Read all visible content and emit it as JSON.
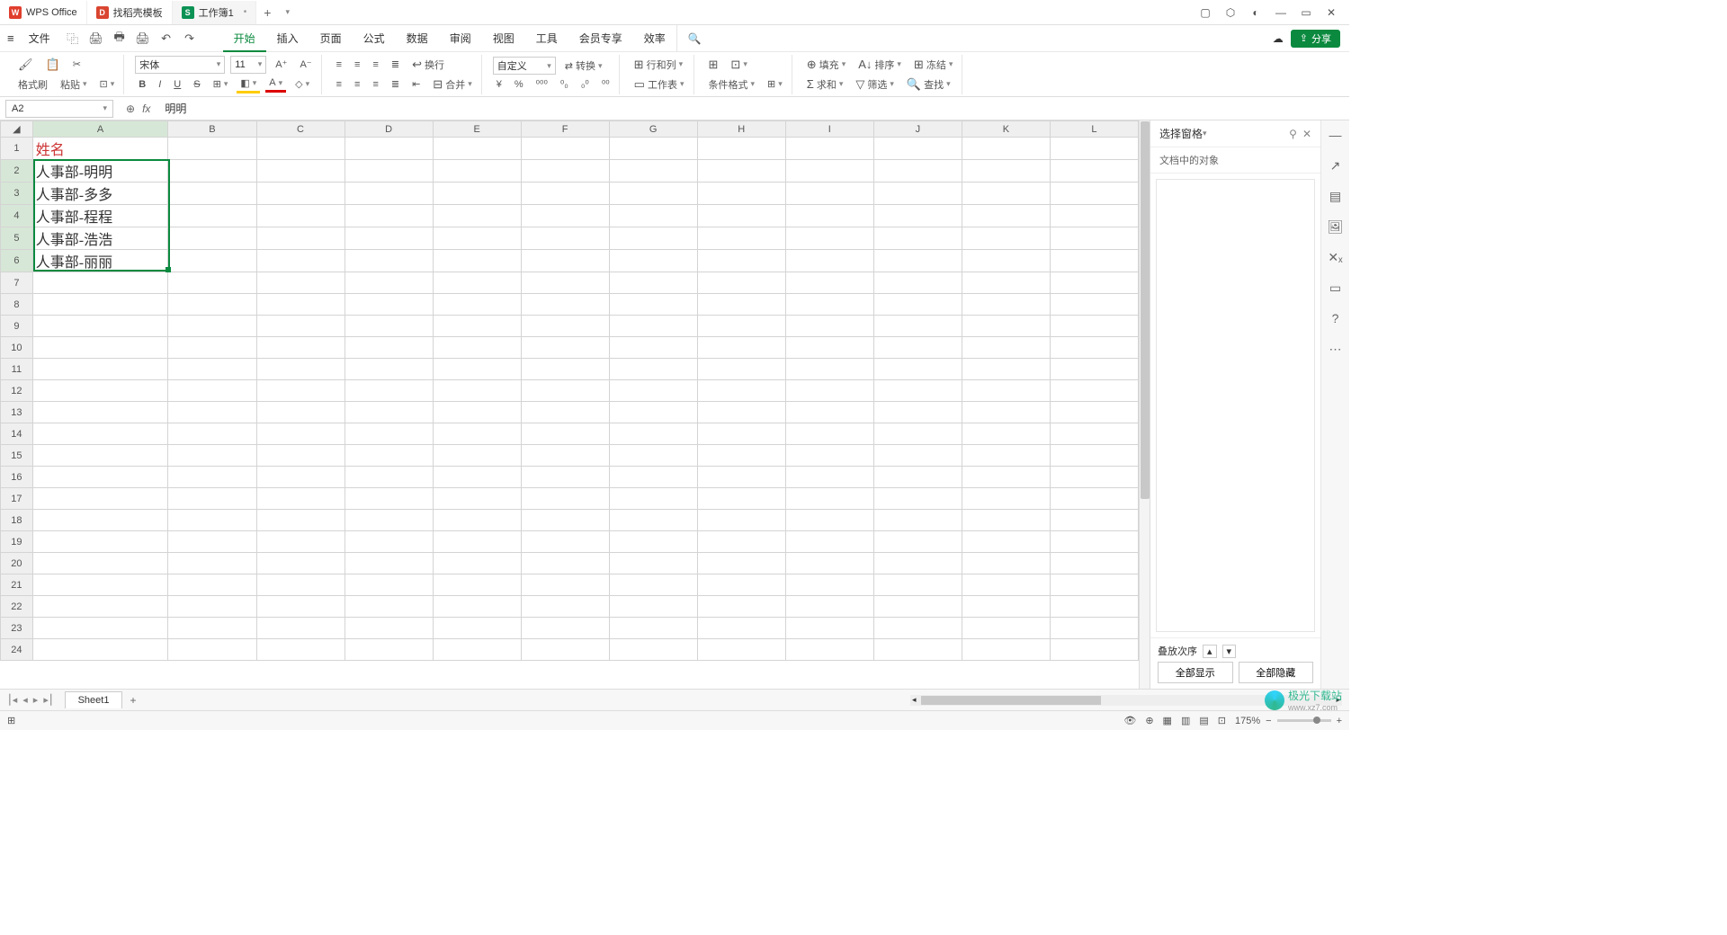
{
  "titlebar": {
    "tabs": [
      {
        "icon": "W",
        "icon_color": "red",
        "label": "WPS Office",
        "close": false
      },
      {
        "icon": "D",
        "icon_color": "dark",
        "label": "找稻壳模板",
        "close": false
      },
      {
        "icon": "S",
        "icon_color": "green",
        "label": "工作簿1",
        "close": true
      }
    ],
    "add": "+",
    "dd": "▾"
  },
  "winicons": [
    "▢",
    "⬡",
    "◐",
    "—",
    "▭",
    "✕"
  ],
  "menubar": {
    "hamburger": "≡",
    "file": "文件",
    "qat": [
      "⿻",
      "🖨",
      "🖶",
      "🖨",
      "↶",
      "↷"
    ],
    "tabs": [
      "开始",
      "插入",
      "页面",
      "公式",
      "数据",
      "审阅",
      "视图",
      "工具",
      "会员专享",
      "效率"
    ],
    "active": 0,
    "search": "🔍",
    "cloud": "☁",
    "share_icon": "⇪",
    "share": "分享"
  },
  "ribbon": {
    "painter": "格式刷",
    "paste": "粘贴",
    "cut": "✂",
    "font": "宋体",
    "size": "11",
    "Aup": "A⁺",
    "Adn": "A⁻",
    "B": "B",
    "I": "I",
    "U": "U",
    "S": "S",
    "box": "⊞",
    "fill": "◧",
    "color": "A",
    "clear": "◇",
    "al": "≡",
    "ac": "≡",
    "ar": "≡",
    "aj": "≣",
    "wrap": "换行",
    "vl": "≡",
    "vc": "≡",
    "vr": "≡",
    "vj": "≣",
    "indent": "⇤",
    "merge": "合并",
    "numfmt": "自定义",
    "convert": "转换",
    "curr": "¥",
    "pct": "%",
    "comma": "⁰⁰⁰",
    "dec1": "⁰₀",
    "dec2": "₀⁰",
    "exp": "⁰⁰",
    "rowcol": "行和列",
    "worksheet": "工作表",
    "tbl": "⊞",
    "style": "⊡",
    "condfmt": "条件格式",
    "border": "⊞",
    "fill2": "填充",
    "sort": "排序",
    "freeze": "冻结",
    "sum": "求和",
    "filter": "筛选",
    "find": "查找"
  },
  "fxbar": {
    "ref": "A2",
    "expand": "⊕",
    "fx": "fx",
    "formula": "明明"
  },
  "columns": [
    "A",
    "B",
    "C",
    "D",
    "E",
    "F",
    "G",
    "H",
    "I",
    "J",
    "K",
    "L"
  ],
  "rows_count": 24,
  "cells": {
    "A1": {
      "v": "姓名",
      "hdr": true
    },
    "A2": {
      "v": "人事部-明明"
    },
    "A3": {
      "v": "人事部-多多"
    },
    "A4": {
      "v": "人事部-程程"
    },
    "A5": {
      "v": "人事部-浩浩"
    },
    "A6": {
      "v": "人事部-丽丽"
    }
  },
  "sidepanel": {
    "title": "选择窗格",
    "dd": "▾",
    "pin": "⚲",
    "close": "✕",
    "sub": "文档中的对象",
    "stack": "叠放次序",
    "up": "▴",
    "down": "▾",
    "show_all": "全部显示",
    "hide_all": "全部隐藏"
  },
  "rightrail": [
    "—",
    "↗",
    "▤",
    "🖼",
    "✕ₓ",
    "▭",
    "?",
    "⋯"
  ],
  "sheetbar": {
    "nav": [
      "⎮◂",
      "◂",
      "▸",
      "▸⎮"
    ],
    "sheet": "Sheet1",
    "add": "+"
  },
  "status": {
    "left": "⊞",
    "eye": "👁",
    "target": "⊕",
    "grid": "▦",
    "g2": "▥",
    "g3": "▤",
    "g4": "⊡",
    "zoom": "175%",
    "minus": "−",
    "plus": "+"
  },
  "watermark": {
    "text": "极光下载站",
    "url": "www.xz7.com"
  }
}
